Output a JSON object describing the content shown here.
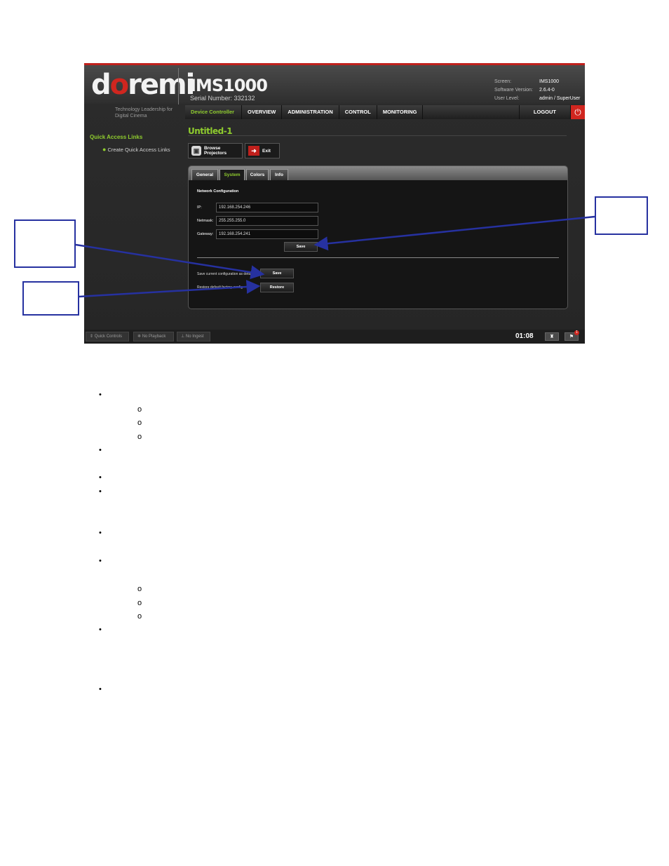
{
  "app": {
    "logo_pre": "d",
    "logo_o": "o",
    "logo_post": "remi",
    "tagline": "Technology Leadership for Digital Cinema",
    "device_name": "IMS1000",
    "serial": "Serial Number: 332132",
    "info": [
      {
        "key": "Screen:",
        "value": "IMS1000"
      },
      {
        "key": "Software Version:",
        "value": "2.6.4-0"
      },
      {
        "key": "User Level:",
        "value": "admin / SuperUser"
      }
    ]
  },
  "nav": {
    "items": [
      "Device Controller",
      "OVERVIEW",
      "ADMINISTRATION",
      "CONTROL",
      "MONITORING"
    ],
    "logout": "LOGOUT",
    "power_icon": "power-icon"
  },
  "sidebar": {
    "title": "Quick Access Links",
    "link": "Create Quick Access Links"
  },
  "page": {
    "title": "Untitled-1",
    "browse_label": "Browse Projectors",
    "exit_label": "Exit"
  },
  "tabs": {
    "general": "General",
    "system": "System",
    "colors": "Colors",
    "info": "Info",
    "active": "System"
  },
  "network": {
    "section_title": "Network Configuration",
    "ip_label": "IP:",
    "ip_value": "192.168.254.246",
    "netmask_label": "Netmask:",
    "netmask_value": "255.255.255.0",
    "gateway_label": "Gateway:",
    "gateway_value": "192.168.254.241",
    "save_label": "Save",
    "save_default_text": "Save current configuration as default",
    "save_default_button": "Save",
    "restore_text": "Restore default factory config",
    "restore_button": "Restore"
  },
  "statusbar": {
    "quick_controls": "Quick Controls",
    "no_playback": "No Playback",
    "no_ingest": "No Ingest",
    "clock": "01:08",
    "badge": "1"
  },
  "colors": {
    "accent_green": "#8fcc2e",
    "brand_red": "#d0261f",
    "callout_blue": "#2631a0"
  }
}
